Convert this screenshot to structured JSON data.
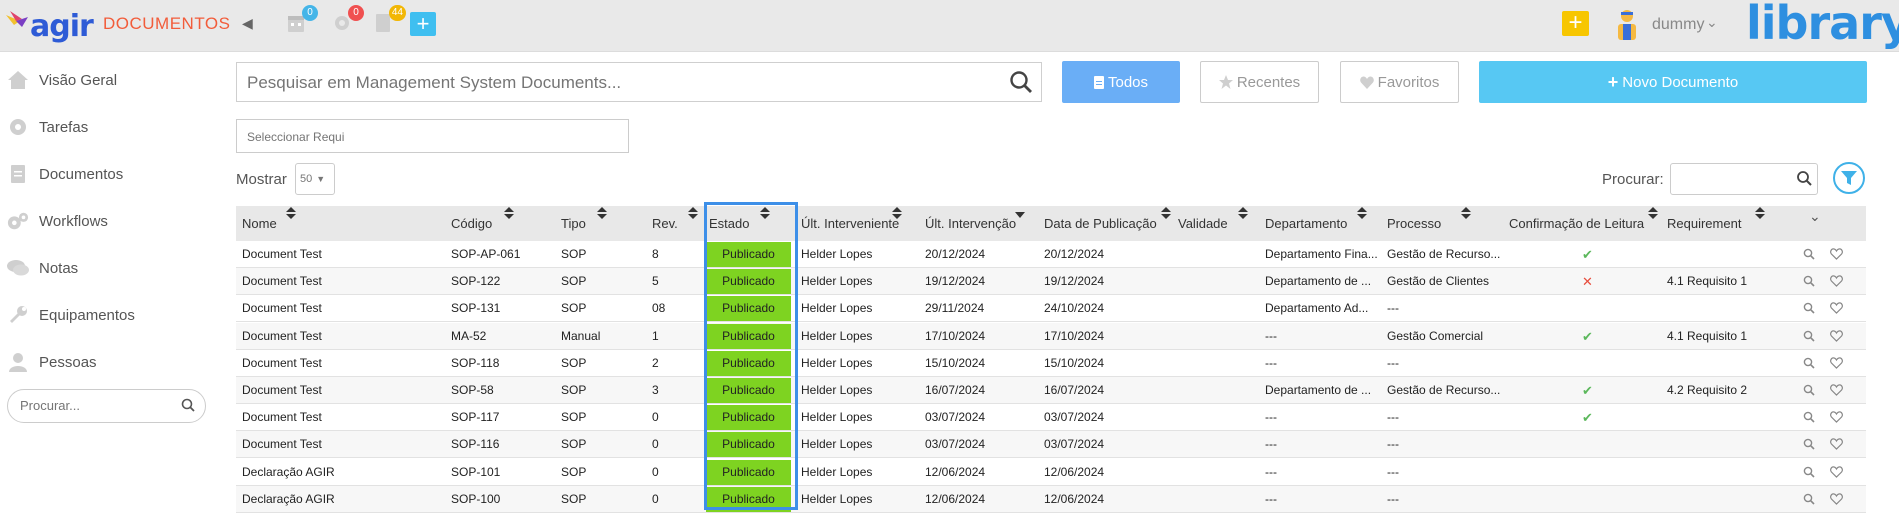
{
  "header": {
    "app_logo_text": "agir",
    "module_title": "DOCUMENTOS",
    "badges": {
      "calendar": "0",
      "tasks": "0",
      "documents": "44"
    },
    "user_name": "dummy",
    "brand": "library",
    "colors": {
      "accent": "#3fbff0",
      "module": "#f25c3a",
      "brand": "#2e8fe0"
    }
  },
  "sidebar": {
    "items": [
      {
        "label": "Visão Geral",
        "icon": "home-icon"
      },
      {
        "label": "Tarefas",
        "icon": "gear-icon"
      },
      {
        "label": "Documentos",
        "icon": "document-icon"
      },
      {
        "label": "Workflows",
        "icon": "gears-icon"
      },
      {
        "label": "Notas",
        "icon": "chat-icon"
      },
      {
        "label": "Equipamentos",
        "icon": "wrench-icon"
      },
      {
        "label": "Pessoas",
        "icon": "person-icon"
      }
    ],
    "search_placeholder": "Procurar..."
  },
  "main": {
    "search_placeholder": "Pesquisar em Management System Documents...",
    "buttons": {
      "todos": "Todos",
      "recentes": "Recentes",
      "favoritos": "Favoritos",
      "novo": "Novo Documento"
    },
    "requirement_placeholder": "Seleccionar Requi",
    "mostrar_label": "Mostrar",
    "mostrar_value": "50",
    "procurar_label": "Procurar:"
  },
  "table": {
    "columns": [
      "Nome",
      "Código",
      "Tipo",
      "Rev.",
      "Estado",
      "Últ. Interveniente",
      "Últ. Intervenção",
      "Data de Publicação",
      "Validade",
      "Departamento",
      "Processo",
      "Confirmação de Leitura",
      "Requirement"
    ],
    "rows": [
      {
        "nome": "Document Test",
        "codigo": "SOP-AP-061",
        "tipo": "SOP",
        "rev": "8",
        "estado": "Publicado",
        "interveniente": "Helder Lopes",
        "intervencao": "20/12/2024",
        "publicacao": "20/12/2024",
        "validade": "",
        "departamento": "Departamento Fina...",
        "processo": "Gestão de Recurso...",
        "confirmacao": "check",
        "requirement": ""
      },
      {
        "nome": "Document Test",
        "codigo": "SOP-122",
        "tipo": "SOP",
        "rev": "5",
        "estado": "Publicado",
        "interveniente": "Helder Lopes",
        "intervencao": "19/12/2024",
        "publicacao": "19/12/2024",
        "validade": "",
        "departamento": "Departamento de ...",
        "processo": "Gestão de Clientes",
        "confirmacao": "cross",
        "requirement": "4.1 Requisito 1"
      },
      {
        "nome": "Document Test",
        "codigo": "SOP-131",
        "tipo": "SOP",
        "rev": "08",
        "estado": "Publicado",
        "interveniente": "Helder Lopes",
        "intervencao": "29/11/2024",
        "publicacao": "24/10/2024",
        "validade": "",
        "departamento": "Departamento Ad...",
        "processo": "---",
        "confirmacao": "",
        "requirement": ""
      },
      {
        "nome": "Document Test",
        "codigo": "MA-52",
        "tipo": "Manual",
        "rev": "1",
        "estado": "Publicado",
        "interveniente": "Helder Lopes",
        "intervencao": "17/10/2024",
        "publicacao": "17/10/2024",
        "validade": "",
        "departamento": "---",
        "processo": "Gestão Comercial",
        "confirmacao": "check",
        "requirement": "4.1 Requisito 1"
      },
      {
        "nome": "Document Test",
        "codigo": "SOP-118",
        "tipo": "SOP",
        "rev": "2",
        "estado": "Publicado",
        "interveniente": "Helder Lopes",
        "intervencao": "15/10/2024",
        "publicacao": "15/10/2024",
        "validade": "",
        "departamento": "---",
        "processo": "---",
        "confirmacao": "",
        "requirement": ""
      },
      {
        "nome": "Document Test",
        "codigo": "SOP-58",
        "tipo": "SOP",
        "rev": "3",
        "estado": "Publicado",
        "interveniente": "Helder Lopes",
        "intervencao": "16/07/2024",
        "publicacao": "16/07/2024",
        "validade": "",
        "departamento": "Departamento de ...",
        "processo": "Gestão de Recurso...",
        "confirmacao": "check",
        "requirement": "4.2 Requisito 2"
      },
      {
        "nome": "Document Test",
        "codigo": "SOP-117",
        "tipo": "SOP",
        "rev": "0",
        "estado": "Publicado",
        "interveniente": "Helder Lopes",
        "intervencao": "03/07/2024",
        "publicacao": "03/07/2024",
        "validade": "",
        "departamento": "---",
        "processo": "---",
        "confirmacao": "check",
        "requirement": ""
      },
      {
        "nome": "Document Test",
        "codigo": "SOP-116",
        "tipo": "SOP",
        "rev": "0",
        "estado": "Publicado",
        "interveniente": "Helder Lopes",
        "intervencao": "03/07/2024",
        "publicacao": "03/07/2024",
        "validade": "",
        "departamento": "---",
        "processo": "---",
        "confirmacao": "",
        "requirement": ""
      },
      {
        "nome": "Declaração AGIR",
        "codigo": "SOP-101",
        "tipo": "SOP",
        "rev": "0",
        "estado": "Publicado",
        "interveniente": "Helder Lopes",
        "intervencao": "12/06/2024",
        "publicacao": "12/06/2024",
        "validade": "",
        "departamento": "---",
        "processo": "---",
        "confirmacao": "",
        "requirement": ""
      },
      {
        "nome": "Declaração AGIR",
        "codigo": "SOP-100",
        "tipo": "SOP",
        "rev": "0",
        "estado": "Publicado",
        "interveniente": "Helder Lopes",
        "intervencao": "12/06/2024",
        "publicacao": "12/06/2024",
        "validade": "",
        "departamento": "---",
        "processo": "---",
        "confirmacao": "",
        "requirement": ""
      }
    ],
    "status_color": "#7ed321"
  }
}
